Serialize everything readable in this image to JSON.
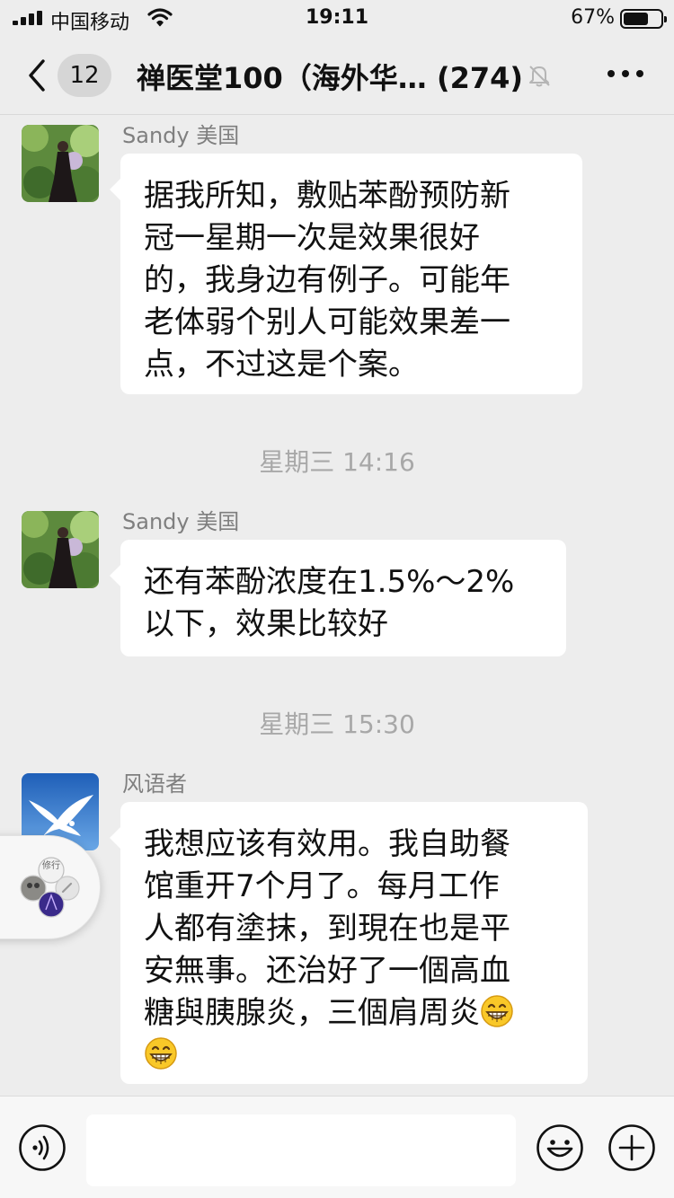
{
  "status_bar": {
    "carrier": "中国移动",
    "time": "19:11",
    "battery_percent": "67%",
    "battery_level": 0.67
  },
  "nav": {
    "back_badge": "12",
    "title": "禅医堂100（海外华… (274)"
  },
  "messages": [
    {
      "type": "message",
      "sender": "Sandy 美国",
      "lines": [
        "据我所知，敷贴苯酚预防新",
        "冠一星期一次是效果很好",
        "的，我身边有例子。可能年",
        "老体弱个别人可能效果差一",
        "点，不过这是个案。"
      ]
    },
    {
      "type": "timestamp",
      "text": "星期三 14:16"
    },
    {
      "type": "message",
      "sender": "Sandy 美国",
      "lines": [
        "还有苯酚浓度在1.5%～2%",
        "以下，效果比较好"
      ]
    },
    {
      "type": "timestamp",
      "text": "星期三 15:30"
    },
    {
      "type": "message",
      "sender": "风语者",
      "lines": [
        "我想应该有效用。我自助餐",
        "馆重开7个月了。每月工作",
        "人都有塗抹，到現在也是平",
        "安無事。还治好了一個高血",
        "糖與胰腺炎，三個肩周炎"
      ]
    }
  ],
  "floating_widget": {
    "label": "修行"
  },
  "input_bar": {
    "value": ""
  },
  "colors": {
    "background": "#ededed",
    "bubble": "#ffffff",
    "timestamp": "#a8a8a8",
    "sender": "#7f7f7f"
  }
}
